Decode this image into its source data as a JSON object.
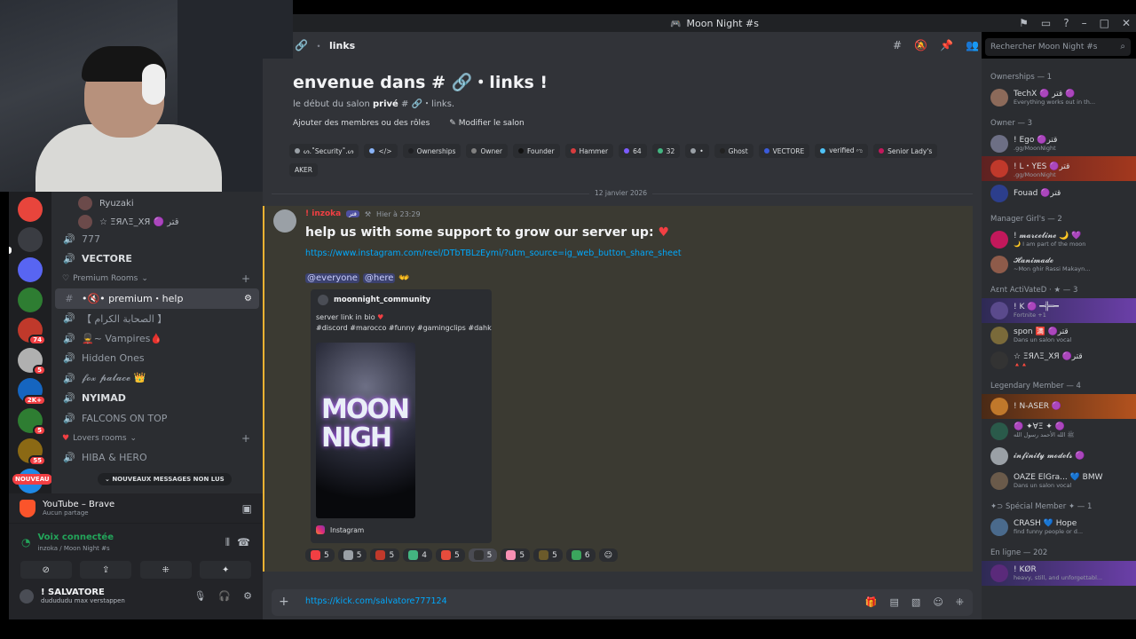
{
  "window": {
    "title": "Moon Night #s"
  },
  "channel_header": {
    "name": "links",
    "search_placeholder": "Rechercher Moon Night #s"
  },
  "servers": {
    "badges": [
      "",
      "",
      "",
      "",
      "74",
      "5",
      "2K+",
      "5",
      "55",
      ""
    ],
    "nouveau_label": "NOUVEAU"
  },
  "channels": {
    "voice_users": [
      {
        "name": "Ryuzaki"
      },
      {
        "name": "☆ ΞЯΛΞ_ΧЯ 🟣 قتر"
      }
    ],
    "list_a": [
      "777",
      "VECTORE"
    ],
    "category_premium": "Premium Rooms",
    "list_b": [
      "•🔇• premium・help",
      "【 الصحابة الكرام 】",
      "💂~ Vampires🩸",
      "Hidden Ones",
      "𝓯𝓸𝔁 𝓹𝓪𝓵𝓪𝓬𝓮 👑",
      "NYIMAD",
      "FALCONS ON TOP"
    ],
    "category_lovers": "Lovers rooms",
    "list_c": [
      "HIBA & HERO"
    ],
    "new_messages_pill": "NOUVEAUX MESSAGES NON LUS"
  },
  "activity": {
    "title": "YouTube – Brave",
    "subtitle": "Aucun partage"
  },
  "voice": {
    "status": "Voix connectée",
    "location": "inzoka / Moon Night #s"
  },
  "user": {
    "name": "! SALVATORE",
    "status": "dudududu max verstappen"
  },
  "welcome": {
    "title": "envenue dans # 🔗・links !",
    "subtitle_pre": "le début du salon ",
    "subtitle_bold": "privé",
    "subtitle_post": " # 🔗・links.",
    "add_members": "Ajouter des membres ou des rôles",
    "edit_channel": "Modifier le salon"
  },
  "roles": [
    {
      "label": "ᔕ.˚Security˚.ᔕ",
      "color": "#9aa0a6"
    },
    {
      "label": "</>",
      "color": "#8ab4f8"
    },
    {
      "label": "Ownerships",
      "color": "#1e1f22"
    },
    {
      "label": "Owner",
      "color": "#808080"
    },
    {
      "label": "Founder",
      "color": "#111111"
    },
    {
      "label": "Hammer",
      "color": "#d83c3e"
    },
    {
      "label": "64",
      "color": "#7c5cff"
    },
    {
      "label": "32",
      "color": "#43b581"
    },
    {
      "label": "•",
      "color": "#9aa0a6"
    },
    {
      "label": "Ghost",
      "color": "#222222"
    },
    {
      "label": "VECTORE",
      "color": "#3b5bdb"
    },
    {
      "label": "verified ಌ",
      "color": "#4fc3f7"
    },
    {
      "label": "Senior Lady's",
      "color": "#c2185b"
    }
  ],
  "roles_more": "AKER",
  "date_divider": "12 janvier 2026",
  "message": {
    "author": "! inzoka",
    "tag": "قتر",
    "time": "Hier à 23:29",
    "headline": "help us with some support to grow our server up:",
    "link": "https://www.instagram.com/reel/DTbTBLzEymi/?utm_source=ig_web_button_share_sheet",
    "mention_everyone": "@everyone",
    "mention_here": "@here",
    "embed": {
      "account": "moonnight_community",
      "line1": "server link in bio",
      "line2": "#discord #marocco #funny #gamingclips #dahk",
      "image_text": "MOON NIGH",
      "footer": "Instagram"
    },
    "reactions": [
      {
        "count": "5",
        "color": "#f23f43"
      },
      {
        "count": "5",
        "color": "#9aa0a6"
      },
      {
        "count": "5",
        "color": "#c0392b"
      },
      {
        "count": "4",
        "color": "#43b581"
      },
      {
        "count": "5",
        "color": "#e74c3c"
      },
      {
        "count": "5",
        "color": "#333333"
      },
      {
        "count": "5",
        "color": "#f78fb3"
      },
      {
        "count": "5",
        "color": "#6b5a2a"
      },
      {
        "count": "6",
        "color": "#3ba55d"
      }
    ]
  },
  "composer": {
    "text": "https://kick.com/salvatore777124"
  },
  "members": {
    "groups": [
      {
        "title": "Ownerships — 1",
        "items": [
          {
            "name": "TechX 🟣 قتر 🟣",
            "status": "Everything works out in th...",
            "color": "#8c6a5a",
            "style": ""
          }
        ]
      },
      {
        "title": "Owner — 3",
        "items": [
          {
            "name": "! Ego 🟣قتر",
            "status": ".gg/MoonNight",
            "color": "#6d6f85",
            "style": ""
          },
          {
            "name": "! L・YES 🟣قتر",
            "status": ".gg/MoonNight",
            "color": "#c0392b",
            "style": "hl"
          },
          {
            "name": "Fouad 🟣قتر",
            "status": "",
            "color": "#2c3e8c",
            "style": ""
          }
        ]
      },
      {
        "title": "Manager Girl's — 2",
        "items": [
          {
            "name": "! 𝓶𝓪𝓻𝓬𝓮𝓵𝓲𝓷𝓮 🌙 💜",
            "status": "🌙 I am part of the moon",
            "color": "#c2185b",
            "style": ""
          },
          {
            "name": "𝓗𝓪𝓷𝓲𝓶𝓪𝓭𝓮",
            "status": "~Mon ghir Rassi Makayn...",
            "color": "#8e5b4a",
            "style": ""
          }
        ]
      },
      {
        "title": "Aεnt ActiVateD · ★ — 3",
        "items": [
          {
            "name": "! K 🟣 ━╬═━",
            "status": "Fortnite +1",
            "color": "#5a4a8c",
            "style": "hl2"
          },
          {
            "name": "spon 🈵 🟣قتر",
            "status": "Dans un salon vocal",
            "color": "#7a6a3a",
            "style": ""
          },
          {
            "name": "☆ ΞЯΛΞ_ΧЯ 🟣قتر",
            "status": "🔺🔺",
            "color": "#333333",
            "style": ""
          }
        ]
      },
      {
        "title": "Legendary Member — 4",
        "items": [
          {
            "name": "! N-ASER 🟣",
            "status": "",
            "color": "#c0782b",
            "style": "hl3"
          },
          {
            "name": "🟣 ✦ⱯΞ ✦ 🟣",
            "status": "ﷺ الله الأحمد رسول الله",
            "color": "#2a5a4a",
            "style": ""
          },
          {
            "name": "𝓲𝓷𝓯𝓲𝓷𝓲𝓽𝔂 𝓶𝓸𝓭𝓮𝓵𝓼 🟣",
            "status": "",
            "color": "#9aa0a6",
            "style": ""
          },
          {
            "name": "OAZE ElGra... 💙 BMW",
            "status": "Dans un salon vocal",
            "color": "#6a5a4a",
            "style": ""
          }
        ]
      },
      {
        "title": "✦⊃ Spécial Member ✦ — 1",
        "items": [
          {
            "name": "CRASH 💙 Hope",
            "status": "find funny people or d...",
            "color": "#4a6a8c",
            "style": ""
          }
        ]
      },
      {
        "title": "En ligne — 202",
        "items": [
          {
            "name": "! KØR",
            "status": "heavy, still, and unforgettabl...",
            "color": "#5a2a7a",
            "style": "hl2"
          }
        ]
      }
    ]
  }
}
